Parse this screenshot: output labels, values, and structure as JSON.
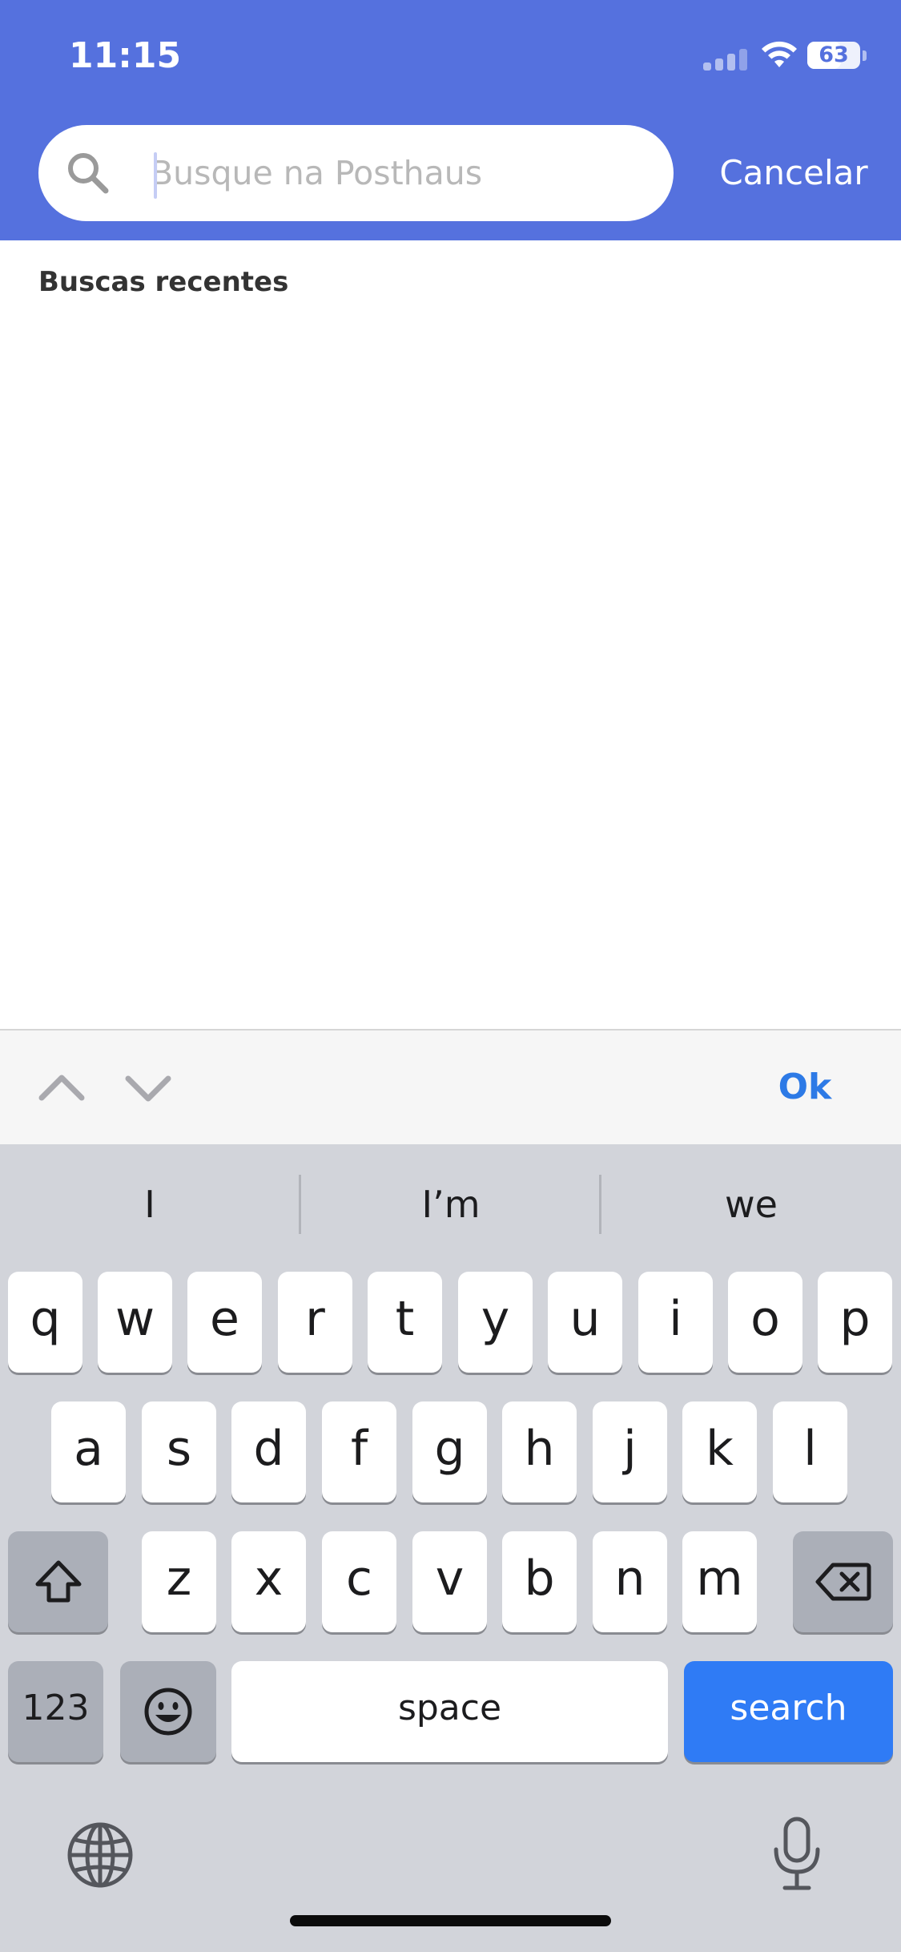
{
  "status_bar": {
    "time": "11:15",
    "battery": "63",
    "battery_level": 0.63
  },
  "search": {
    "placeholder": "Busque na Posthaus",
    "value": "",
    "cancel_label": "Cancelar"
  },
  "content": {
    "recent_title": "Buscas recentes"
  },
  "accessory": {
    "ok_label": "Ok"
  },
  "keyboard": {
    "suggestions": [
      "I",
      "I’m",
      "we"
    ],
    "row1": [
      "q",
      "w",
      "e",
      "r",
      "t",
      "y",
      "u",
      "i",
      "o",
      "p"
    ],
    "row2": [
      "a",
      "s",
      "d",
      "f",
      "g",
      "h",
      "j",
      "k",
      "l"
    ],
    "row3": [
      "z",
      "x",
      "c",
      "v",
      "b",
      "n",
      "m"
    ],
    "numbers_label": "123",
    "space_label": "space",
    "search_label": "search"
  },
  "colors": {
    "header": "#5571de",
    "ok": "#2d7ae6",
    "search_key": "#2f7bf5",
    "keyboard_bg": "#d2d4da"
  }
}
